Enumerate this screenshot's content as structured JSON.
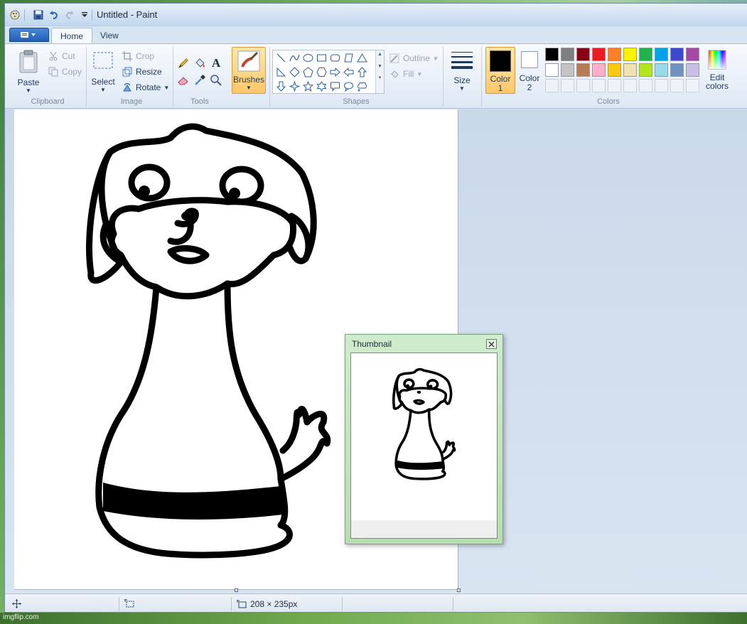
{
  "window": {
    "title": "Untitled - Paint"
  },
  "tabs": [
    {
      "label": "Home",
      "active": true
    },
    {
      "label": "View",
      "active": false
    }
  ],
  "clipboard": {
    "paste_label": "Paste",
    "cut_label": "Cut",
    "copy_label": "Copy",
    "group_label": "Clipboard"
  },
  "image": {
    "select_label": "Select",
    "crop_label": "Crop",
    "resize_label": "Resize",
    "rotate_label": "Rotate",
    "group_label": "Image"
  },
  "tools": {
    "group_label": "Tools",
    "text_tool_glyph": "A"
  },
  "brushes": {
    "label": "Brushes"
  },
  "shapes": {
    "outline_label": "Outline",
    "fill_label": "Fill",
    "group_label": "Shapes"
  },
  "size": {
    "label": "Size"
  },
  "colors": {
    "color1_label": "Color 1",
    "color1_line1": "Color",
    "color1_line2": "1",
    "color2_label": "Color 2",
    "color2_line1": "Color",
    "color2_line2": "2",
    "color1_value": "#000000",
    "color2_value": "#ffffff",
    "edit_line1": "Edit",
    "edit_line2": "colors",
    "group_label": "Colors",
    "palette_row1": [
      "#000000",
      "#7f7f7f",
      "#880015",
      "#ed1c24",
      "#ff7f27",
      "#fff200",
      "#22b14c",
      "#00a2e8",
      "#3f48cc",
      "#a349a4"
    ],
    "palette_row2": [
      "#ffffff",
      "#c3c3c3",
      "#b97a57",
      "#ffaec9",
      "#ffc90e",
      "#efe4b0",
      "#b5e61d",
      "#99d9ea",
      "#7092be",
      "#c8bfe7"
    ]
  },
  "thumbnail": {
    "title": "Thumbnail"
  },
  "status": {
    "image_size": "208 × 235px"
  },
  "watermark": {
    "text": "imgflip.com"
  }
}
